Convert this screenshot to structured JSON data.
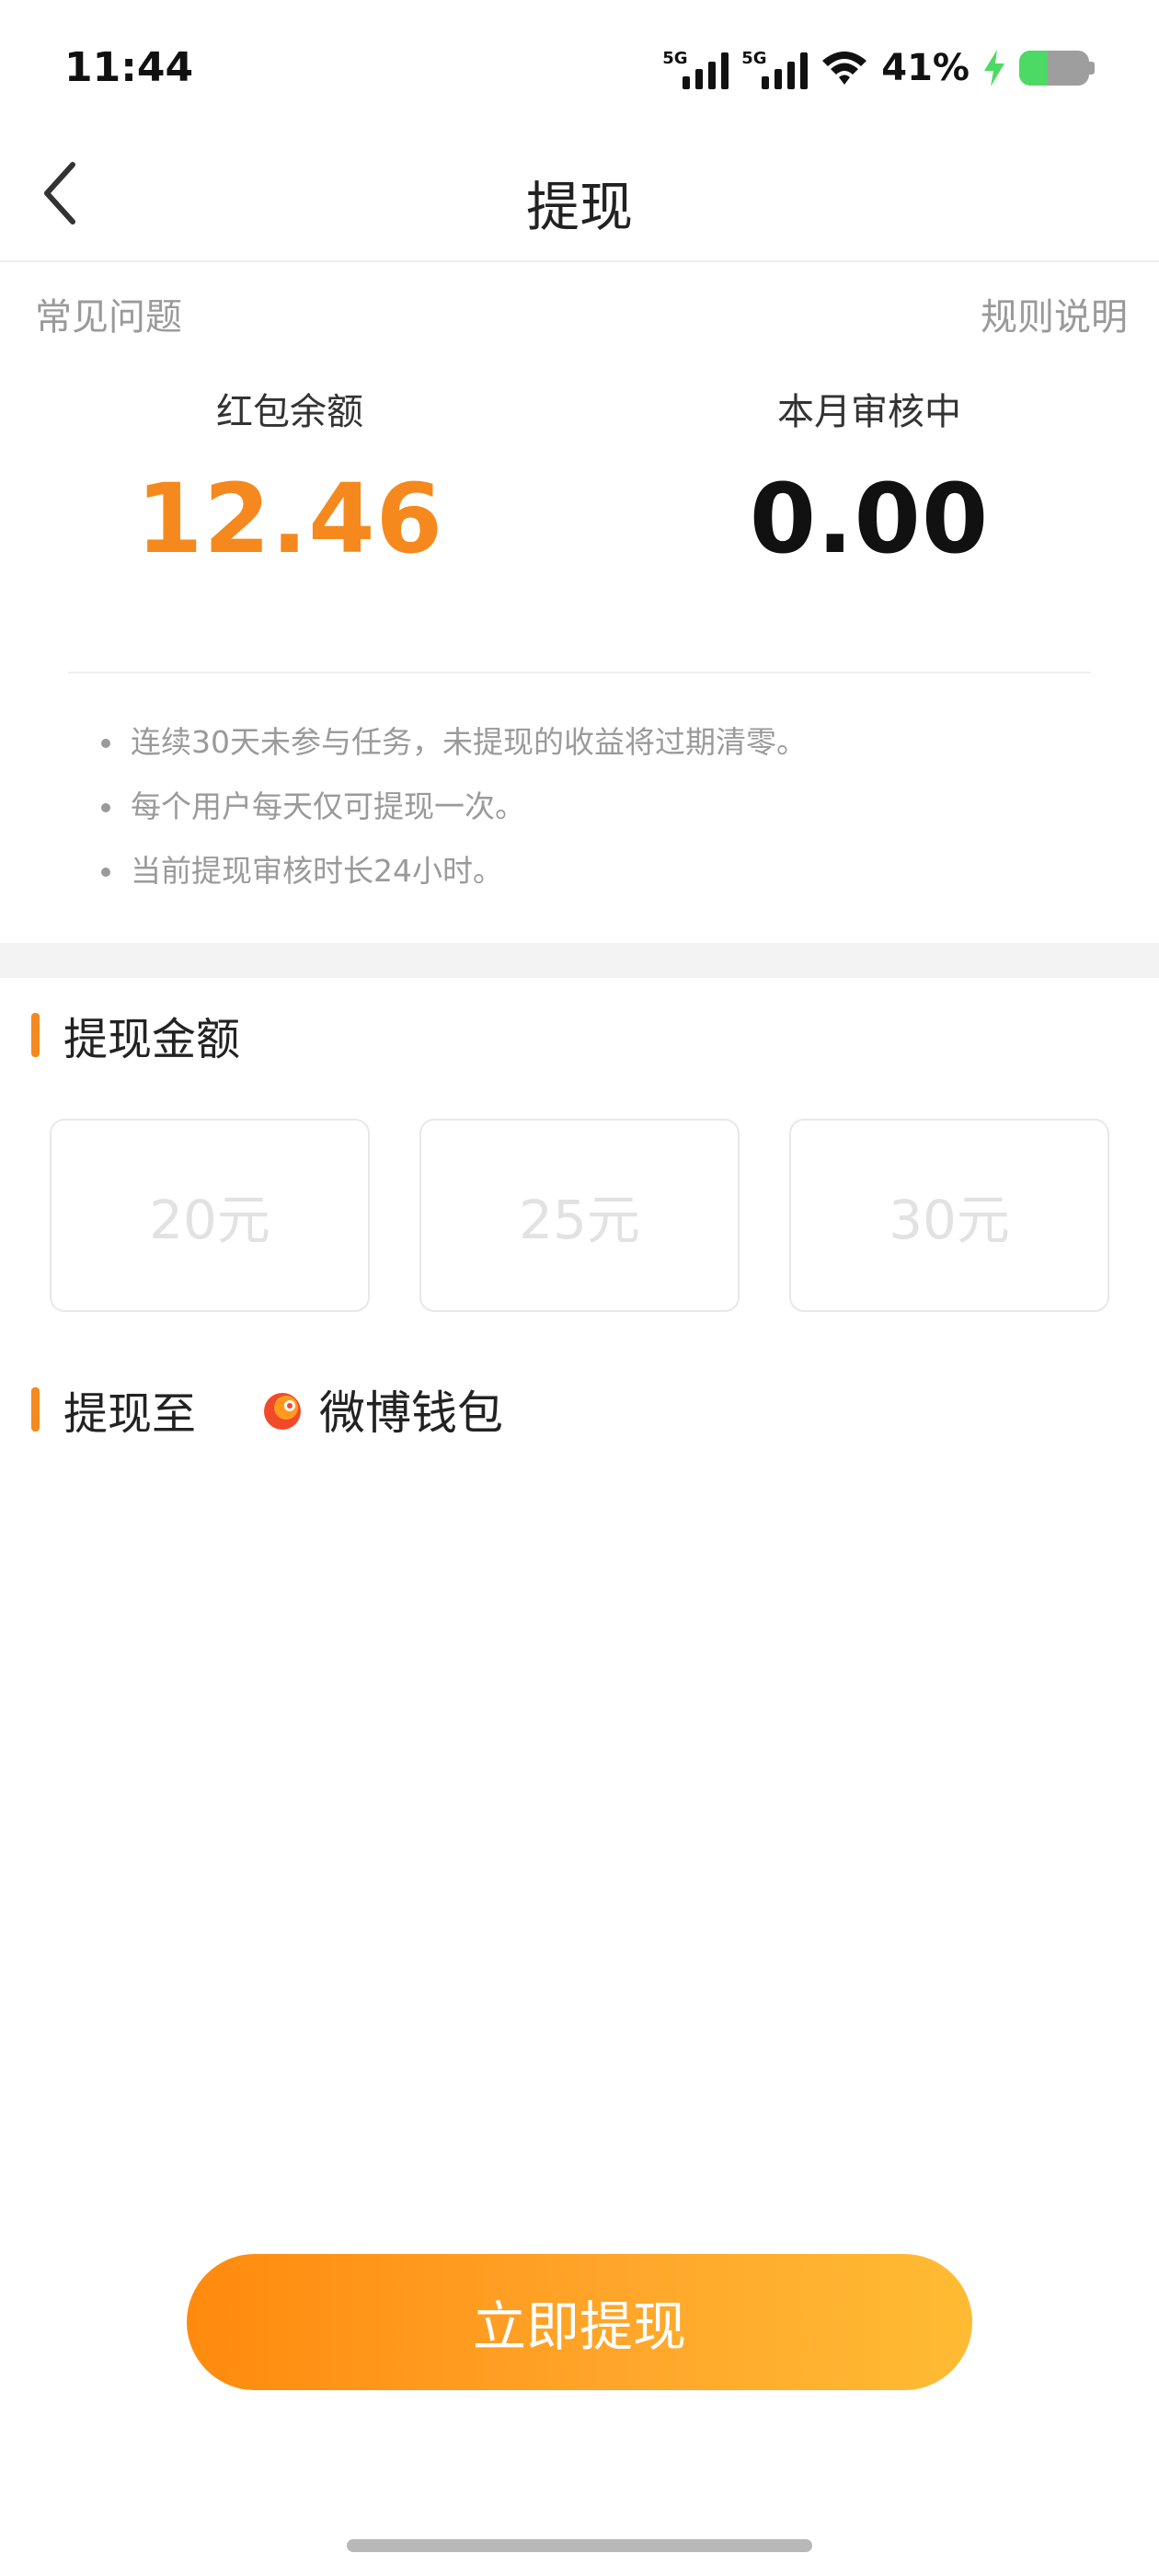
{
  "status_bar": {
    "time": "11:44",
    "signal1_tag": "5G",
    "signal2_tag": "5G",
    "battery_percent": "41%",
    "battery_level": 0.41,
    "charging": true,
    "icons": [
      "signal-icon",
      "wifi-icon",
      "charging-bolt-icon",
      "battery-icon"
    ]
  },
  "nav": {
    "title": "提现",
    "back_icon": "chevron-left-icon"
  },
  "links": {
    "faq": "常见问题",
    "rules": "规则说明"
  },
  "balances": {
    "red_packet_label": "红包余额",
    "red_packet_value": "12.46",
    "reviewing_label": "本月审核中",
    "reviewing_value": "0.00"
  },
  "notes": [
    "连续30天未参与任务，未提现的收益将过期清零。",
    "每个用户每天仅可提现一次。",
    "当前提现审核时长24小时。"
  ],
  "amount_section": {
    "title": "提现金额",
    "options": [
      "20元",
      "25元",
      "30元"
    ]
  },
  "destination_section": {
    "title": "提现至",
    "wallet_name": "微博钱包",
    "wallet_icon": "weibo-wallet-icon"
  },
  "cta": {
    "label": "立即提现"
  },
  "colors": {
    "accent": "#f5891e",
    "cta_gradient_start": "#ff8a0e",
    "cta_gradient_end": "#ffbb33",
    "muted_text": "#9a9a9a"
  }
}
